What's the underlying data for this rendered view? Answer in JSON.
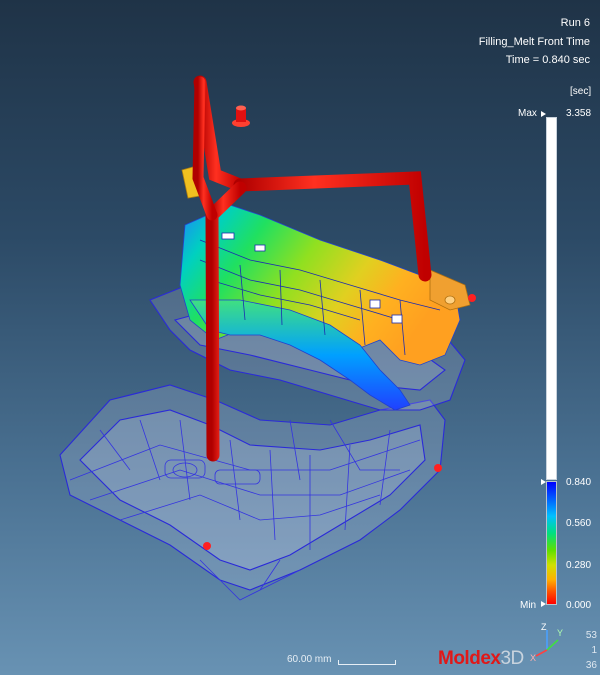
{
  "info": {
    "run": "Run 6",
    "result": "Filling_Melt Front Time",
    "time": "Time = 0.840 sec"
  },
  "legend": {
    "unit": "[sec]",
    "max_label": "Max",
    "max_value": "3.358",
    "current_value": "0.840",
    "tick_1": "0.560",
    "tick_2": "0.280",
    "min_label": "Min",
    "min_value": "0.000"
  },
  "scale": {
    "label": "60.00 mm"
  },
  "logo": {
    "brand_main": "Moldex",
    "brand_suffix": "3D"
  },
  "axes": {
    "z": "Z",
    "y": "Y",
    "x": "X",
    "num_1": "53",
    "num_2": "1",
    "num_3": "36"
  },
  "colors": {
    "runner": "#e01010",
    "mesh": "#2a2ad8",
    "background_top": "#1f3347",
    "background_bottom": "#6892b3"
  }
}
